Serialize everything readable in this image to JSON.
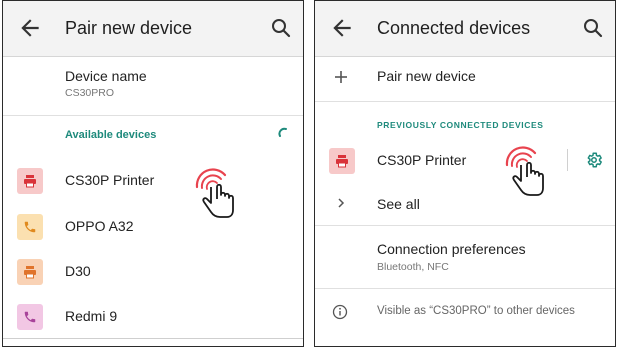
{
  "left": {
    "title": "Pair new device",
    "device_name_label": "Device name",
    "device_name_value": "CS30PRO",
    "available_label": "Available devices",
    "devices": [
      {
        "name": "CS30P Printer",
        "icon": "printer-icon",
        "bg": "#f7c9c9",
        "fg": "#d9333a"
      },
      {
        "name": "OPPO A32",
        "icon": "phone-icon",
        "bg": "#fbe0b0",
        "fg": "#e08a1e"
      },
      {
        "name": "D30",
        "icon": "printer-icon",
        "bg": "#f9d2b5",
        "fg": "#e0742c"
      },
      {
        "name": "Redmi 9",
        "icon": "phone-icon",
        "bg": "#f2c7e4",
        "fg": "#a8439a"
      }
    ]
  },
  "right": {
    "title": "Connected devices",
    "pair_new": "Pair new device",
    "previous_label": "PREVIOUSLY CONNECTED DEVICES",
    "printer_name": "CS30P Printer",
    "see_all": "See all",
    "connection_pref": "Connection preferences",
    "connection_sub": "Bluetooth, NFC",
    "visible_note": "Visible as “CS30PRO” to other devices"
  },
  "colors": {
    "accent": "#1e8a7c",
    "tap_ring": "#e8434e"
  }
}
